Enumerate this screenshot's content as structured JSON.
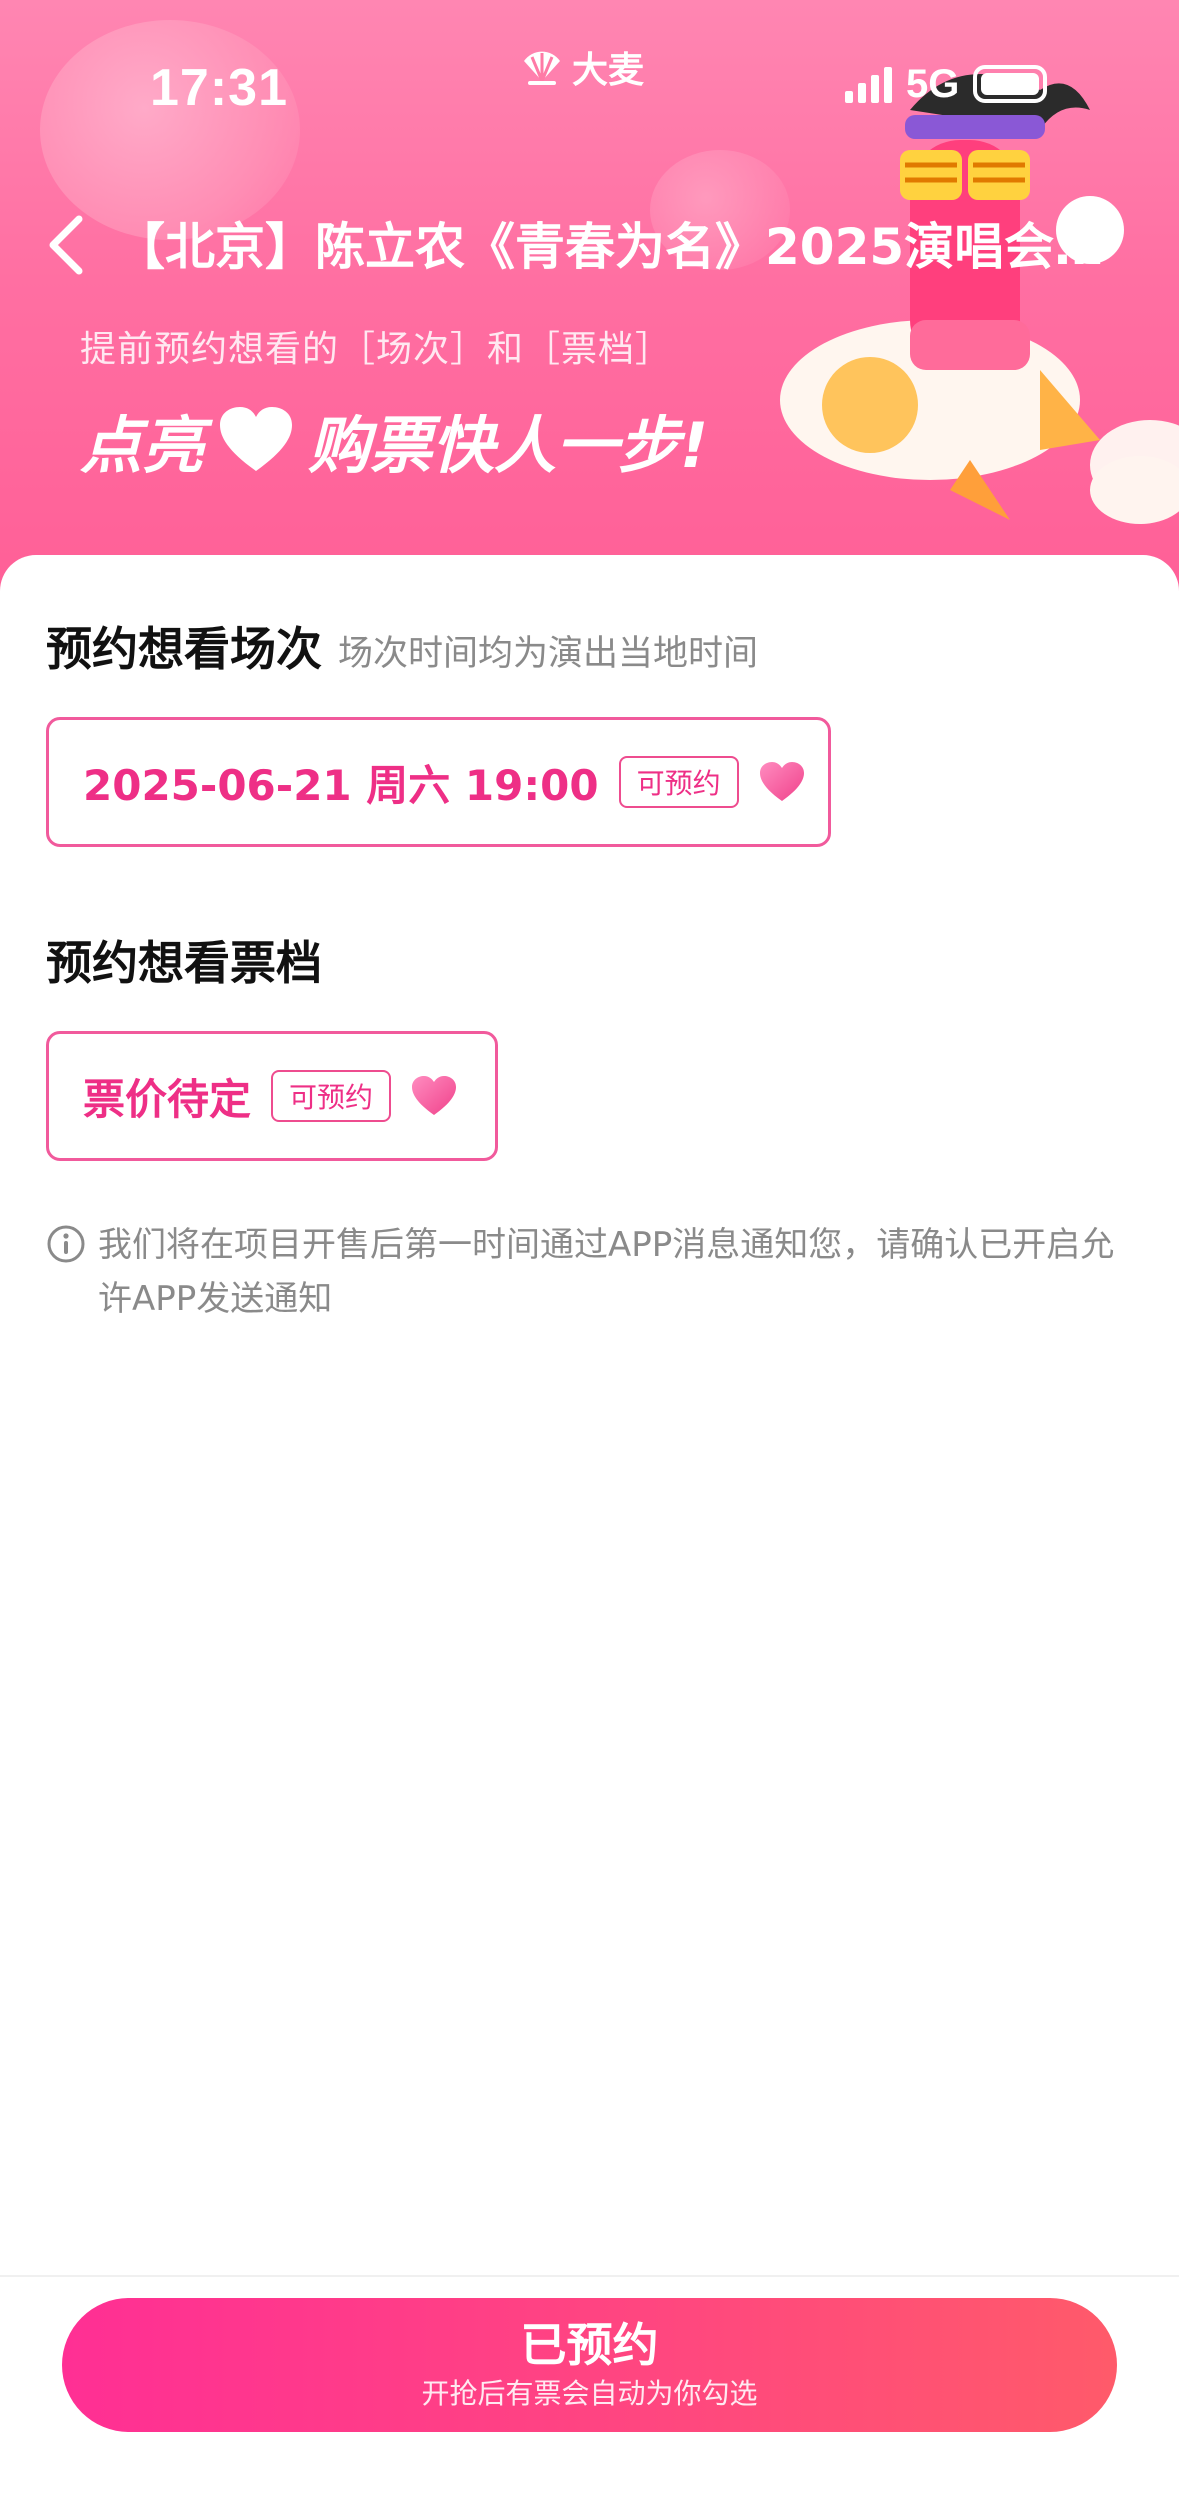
{
  "status_bar": {
    "time": "17:31",
    "network": "5G"
  },
  "brand": {
    "name": "大麦"
  },
  "header": {
    "title": "【北京】陈立农《青春为名》2025演唱会-...",
    "subtitle": "提前预约想看的［场次］和［票档］",
    "slogan_left": "点亮",
    "slogan_right": "购票快人一步!"
  },
  "session_section": {
    "title": "预约想看场次",
    "note": "场次时间均为演出当地时间",
    "options": [
      {
        "label": "2025-06-21 周六 19:00",
        "tag": "可预约"
      }
    ]
  },
  "ticket_section": {
    "title": "预约想看票档",
    "options": [
      {
        "label": "票价待定",
        "tag": "可预约"
      }
    ]
  },
  "notice": {
    "text": "我们将在项目开售后第一时间通过APP消息通知您，请确认已开启允许APP发送通知"
  },
  "cta": {
    "label": "已预约",
    "sublabel": "开抢后有票会自动为你勾选"
  },
  "colors": {
    "accent": "#ee2f86",
    "banner": "#ff6fa2",
    "cta_start": "#ff2f94",
    "cta_end": "#ff5a6a",
    "muted_text": "#8a8a8a"
  },
  "icons": [
    "back-arrow-icon",
    "brand-fan-icon",
    "signal-icon",
    "battery-icon",
    "heart-icon",
    "info-icon"
  ]
}
